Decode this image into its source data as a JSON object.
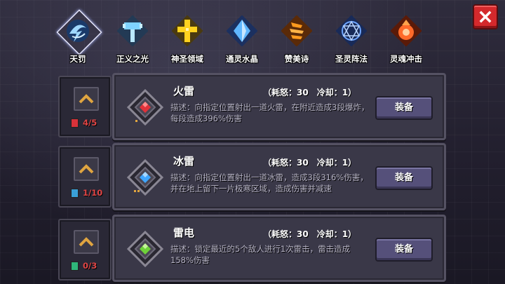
{
  "close_button": {
    "icon": "close-icon"
  },
  "tabs": [
    {
      "label": "天罚",
      "icon": "lightning-swirl-icon",
      "color": "#9fd7ff",
      "selected": true
    },
    {
      "label": "正义之光",
      "icon": "hammer-icon",
      "color": "#7fd2ff",
      "selected": false
    },
    {
      "label": "神圣领域",
      "icon": "holy-cross-icon",
      "color": "#ffd21f",
      "selected": false
    },
    {
      "label": "通灵水晶",
      "icon": "crystal-icon",
      "color": "#5fb6ff",
      "selected": false
    },
    {
      "label": "赞美诗",
      "icon": "hymn-flame-icon",
      "color": "#ff9a1e",
      "selected": false
    },
    {
      "label": "圣灵阵法",
      "icon": "magic-circle-icon",
      "color": "#6fa6ff",
      "selected": false
    },
    {
      "label": "灵魂冲击",
      "icon": "soul-blast-icon",
      "color": "#ff6a2a",
      "selected": false
    }
  ],
  "skills": [
    {
      "name": "火雷",
      "stats": "（耗怒：30　冷却：1）",
      "description": "描述：向指定位置射出一道火雷，在附近造成3段爆炸，每段造成396%伤害",
      "gem_color": "#e0323a",
      "gem_icon": "red-gem-icon",
      "equip_label": "装备",
      "level": "4/5",
      "level_color": "#e04545",
      "level_icon_color": "#d8323a"
    },
    {
      "name": "冰雷",
      "stats": "（耗怒：30　冷却：1）",
      "description": "描述：向指定位置射出一道冰雷，造成3段316%伤害，并在地上留下一片极寒区域，造成伤害并减速",
      "gem_color": "#3fa6ff",
      "gem_icon": "blue-gem-icon",
      "equip_label": "装备",
      "level": "1/10",
      "level_color": "#e04545",
      "level_icon_color": "#3aa0d8"
    },
    {
      "name": "雷电",
      "stats": "（耗怒：30　冷却：1）",
      "description": "描述：锁定最近的5个敌人进行1次雷击，雷击造成158%伤害",
      "gem_color": "#6fd23a",
      "gem_icon": "green-gem-icon",
      "equip_label": "装备",
      "level": "0/3",
      "level_color": "#e04545",
      "level_icon_color": "#2fb67a"
    }
  ]
}
